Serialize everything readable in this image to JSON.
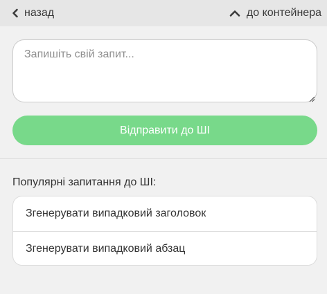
{
  "topbar": {
    "back_label": "назад",
    "back_icon": "chevron-left-icon",
    "up_label": "до контейнера",
    "up_icon": "chevron-up-icon"
  },
  "prompt": {
    "placeholder": "Запишіть свій запит...",
    "value": ""
  },
  "send_button": {
    "label": "Відправити до ШІ"
  },
  "popular": {
    "heading": "Популярні запитання до ШІ:",
    "items": [
      {
        "label": "Згенерувати випадковий заголовок"
      },
      {
        "label": "Згенерувати випадковий абзац"
      }
    ]
  },
  "colors": {
    "accent": "#78d98a",
    "page_background": "#f1f1f1",
    "topbar_background": "#e6e6e6"
  }
}
